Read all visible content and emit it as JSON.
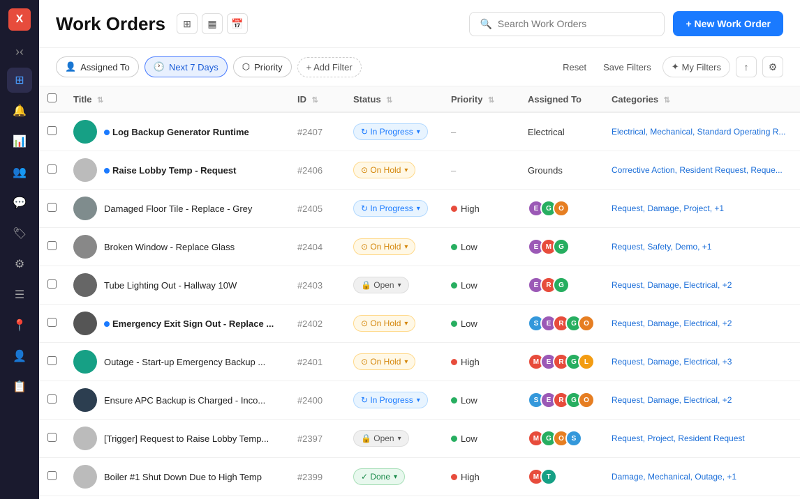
{
  "app": {
    "logo": "X",
    "title": "Work Orders",
    "search_placeholder": "Search Work Orders",
    "new_order_label": "+ New Work Order"
  },
  "filters": {
    "assigned_to": "Assigned To",
    "next_days": "Next 7 Days",
    "priority": "Priority",
    "add_filter": "+ Add Filter",
    "reset": "Reset",
    "save_filters": "Save Filters",
    "my_filters": "My Filters"
  },
  "table": {
    "columns": [
      "Title",
      "ID",
      "Status",
      "Priority",
      "Assigned To",
      "Categories"
    ],
    "rows": [
      {
        "id": "#2407",
        "title": "Log Backup Generator Runtime",
        "bold": true,
        "has_dot": true,
        "status": "In Progress",
        "status_type": "in-progress",
        "priority": "",
        "priority_type": "none",
        "assigned_text": "Electrical",
        "categories": "Electrical, Mechanical, Standard Operating R...",
        "avatar_color": "av-teal",
        "avatar_initials": ""
      },
      {
        "id": "#2406",
        "title": "Raise Lobby Temp - Request",
        "bold": true,
        "has_dot": true,
        "status": "On Hold",
        "status_type": "on-hold",
        "priority": "",
        "priority_type": "none",
        "assigned_text": "Grounds",
        "categories": "Corrective Action, Resident Request, Reque...",
        "avatar_color": "av-photo",
        "avatar_initials": ""
      },
      {
        "id": "#2405",
        "title": "Damaged Floor Tile - Replace - Grey",
        "bold": false,
        "has_dot": false,
        "status": "In Progress",
        "status_type": "in-progress",
        "priority": "High",
        "priority_type": "high",
        "assigned_avatars": [
          {
            "initials": "E",
            "color": "av-e"
          },
          {
            "initials": "G",
            "color": "av-g"
          },
          {
            "initials": "O",
            "color": "av-o"
          }
        ],
        "categories": "Request, Damage, Project, +1",
        "avatar_color": "av-photo",
        "avatar_initials": ""
      },
      {
        "id": "#2404",
        "title": "Broken Window - Replace Glass",
        "bold": false,
        "has_dot": false,
        "status": "On Hold",
        "status_type": "on-hold",
        "priority": "Low",
        "priority_type": "low",
        "assigned_avatars": [
          {
            "initials": "E",
            "color": "av-e"
          },
          {
            "initials": "M",
            "color": "av-m"
          },
          {
            "initials": "G",
            "color": "av-g"
          }
        ],
        "categories": "Request, Safety, Demo, +1",
        "avatar_color": "av-photo",
        "avatar_initials": ""
      },
      {
        "id": "#2403",
        "title": "Tube Lighting Out - Hallway 10W",
        "bold": false,
        "has_dot": false,
        "status": "Open",
        "status_type": "open",
        "priority": "Low",
        "priority_type": "low",
        "assigned_avatars": [
          {
            "initials": "E",
            "color": "av-e"
          },
          {
            "initials": "R",
            "color": "av-r"
          },
          {
            "initials": "G",
            "color": "av-g"
          }
        ],
        "categories": "Request, Damage, Electrical, +2",
        "avatar_color": "av-photo",
        "avatar_initials": ""
      },
      {
        "id": "#2402",
        "title": "Emergency Exit Sign Out - Replace ...",
        "bold": true,
        "has_dot": true,
        "status": "On Hold",
        "status_type": "on-hold",
        "priority": "Low",
        "priority_type": "low",
        "assigned_avatars": [
          {
            "initials": "S",
            "color": "av-s"
          },
          {
            "initials": "E",
            "color": "av-e"
          },
          {
            "initials": "R",
            "color": "av-r"
          },
          {
            "initials": "G",
            "color": "av-g"
          },
          {
            "initials": "O",
            "color": "av-o"
          }
        ],
        "categories": "Request, Damage, Electrical, +2",
        "avatar_color": "av-photo",
        "avatar_initials": ""
      },
      {
        "id": "#2401",
        "title": "Outage - Start-up Emergency Backup ...",
        "bold": false,
        "has_dot": false,
        "status": "On Hold",
        "status_type": "on-hold",
        "priority": "High",
        "priority_type": "high",
        "assigned_avatars": [
          {
            "initials": "M",
            "color": "av-m"
          },
          {
            "initials": "E",
            "color": "av-e"
          },
          {
            "initials": "R",
            "color": "av-r"
          },
          {
            "initials": "G",
            "color": "av-g"
          },
          {
            "initials": "L",
            "color": "av-l"
          }
        ],
        "categories": "Request, Damage, Electrical, +3",
        "avatar_color": "av-teal",
        "avatar_initials": ""
      },
      {
        "id": "#2400",
        "title": "Ensure APC Backup is Charged - Inco...",
        "bold": false,
        "has_dot": false,
        "status": "In Progress",
        "status_type": "in-progress",
        "priority": "Low",
        "priority_type": "low",
        "assigned_avatars": [
          {
            "initials": "S",
            "color": "av-s"
          },
          {
            "initials": "E",
            "color": "av-e"
          },
          {
            "initials": "R",
            "color": "av-r"
          },
          {
            "initials": "G",
            "color": "av-g"
          },
          {
            "initials": "O",
            "color": "av-o"
          }
        ],
        "categories": "Request, Damage, Electrical, +2",
        "avatar_color": "av-darkblue",
        "avatar_initials": ""
      },
      {
        "id": "#2397",
        "title": "[Trigger] Request to Raise Lobby Temp...",
        "bold": false,
        "has_dot": false,
        "status": "Open",
        "status_type": "open",
        "priority": "Low",
        "priority_type": "low",
        "assigned_avatars": [
          {
            "initials": "M",
            "color": "av-m"
          },
          {
            "initials": "G",
            "color": "av-g"
          },
          {
            "initials": "O",
            "color": "av-o"
          },
          {
            "initials": "S",
            "color": "av-s"
          }
        ],
        "categories": "Request, Project, Resident Request",
        "avatar_color": "av-photo",
        "avatar_initials": ""
      },
      {
        "id": "#2399",
        "title": "Boiler #1 Shut Down Due to High Temp",
        "bold": false,
        "has_dot": false,
        "status": "Done",
        "status_type": "done",
        "priority": "High",
        "priority_type": "high",
        "assigned_avatars": [
          {
            "initials": "M",
            "color": "av-m"
          },
          {
            "initials": "T",
            "color": "av-teal"
          }
        ],
        "categories": "Damage, Mechanical, Outage, +1",
        "avatar_color": "av-photo",
        "avatar_initials": ""
      }
    ]
  },
  "sidebar": {
    "logo": "X",
    "nav_items": [
      "≡",
      "◻",
      "⊞",
      "☰",
      "◯",
      "◈",
      "☰",
      "◯",
      "👤",
      "☰"
    ]
  }
}
